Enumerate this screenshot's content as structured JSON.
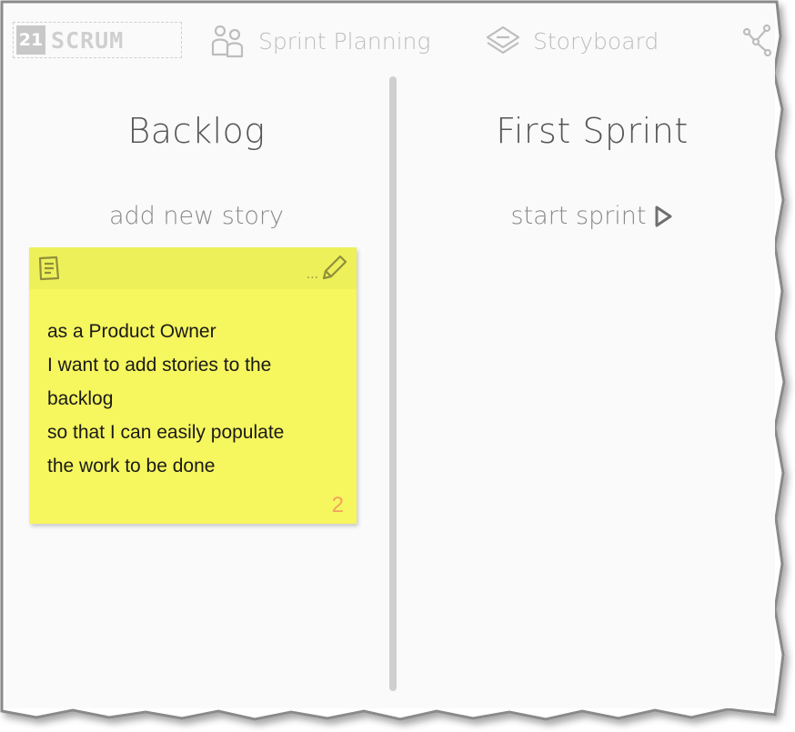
{
  "nav": {
    "logo_number": "21",
    "logo_text": "SCRUM",
    "sprint_planning": "Sprint Planning",
    "storyboard": "Storyboard"
  },
  "backlog": {
    "title": "Backlog",
    "add_label": "add new story",
    "story": {
      "lines": [
        "as a Product Owner",
        "I want to add stories to the",
        "backlog",
        "so that I can easily populate",
        "the work to be done"
      ],
      "points": "2",
      "ellipsis": "..."
    }
  },
  "sprint": {
    "title": "First Sprint",
    "start_label": "start sprint"
  },
  "colors": {
    "card_yellow": "#f6f65e",
    "card_header": "#eef05a",
    "points_orange": "#f2a35e",
    "nav_gray": "#bdbdbd"
  },
  "icons": {
    "sprint_planning": "jigsaw-people-icon",
    "storyboard": "layers-icon",
    "graph": "chart-nodes-icon",
    "note": "note-icon",
    "edit": "pencil-icon",
    "start": "play-triangle-icon"
  }
}
